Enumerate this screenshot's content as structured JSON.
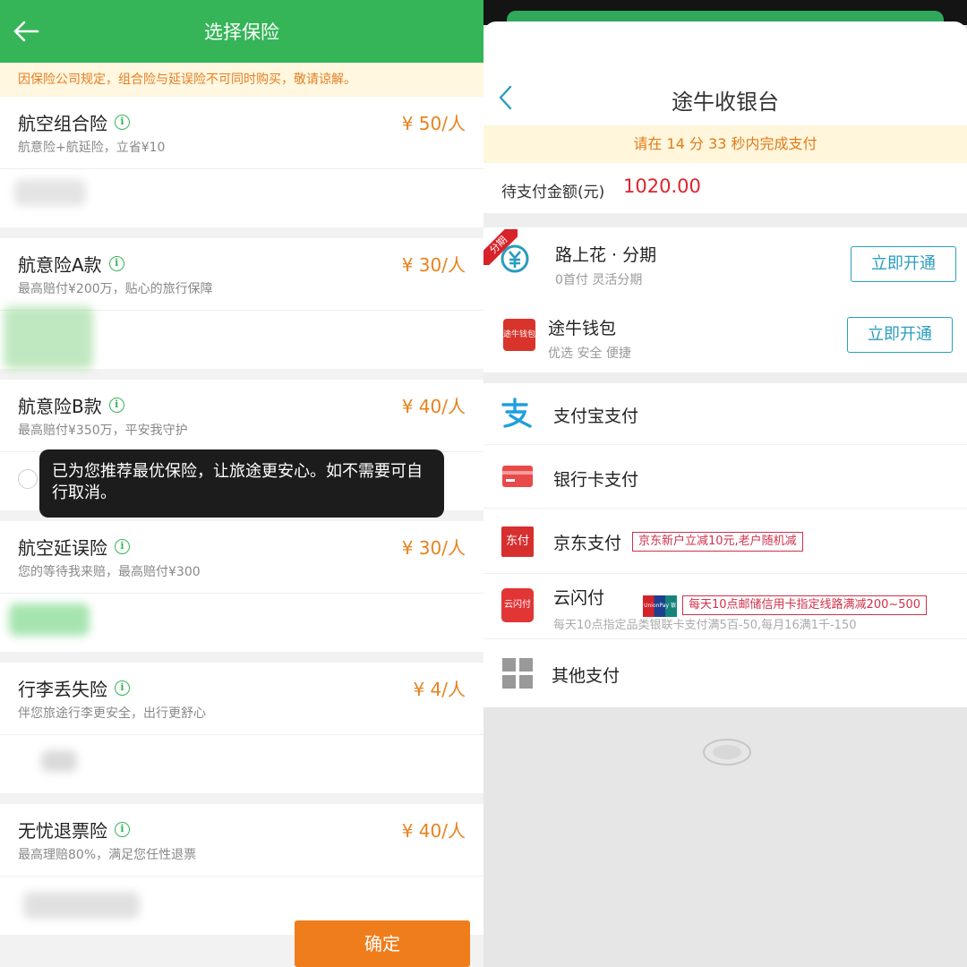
{
  "left": {
    "header": {
      "title": "选择保险"
    },
    "notice": "因保险公司规定，组合险与延误险不可同时购买，敬请谅解。",
    "insurances": [
      {
        "name": "航空组合险",
        "price": "¥ 50/人",
        "desc": "航意险+航延险，立省¥10"
      },
      {
        "name": "航意险A款",
        "price": "¥ 30/人",
        "desc": "最高赔付¥200万，贴心的旅行保障"
      },
      {
        "name": "航意险B款",
        "price": "¥ 40/人",
        "desc": "最高赔付¥350万，平安我守护"
      },
      {
        "name": "航空延误险",
        "price": "¥ 30/人",
        "desc": "您的等待我来赔，最高赔付¥300"
      },
      {
        "name": "行李丢失险",
        "price": "¥ 4/人",
        "desc": "伴您旅途行李更安全，出行更舒心"
      },
      {
        "name": "无忧退票险",
        "price": "¥ 40/人",
        "desc": "最高理赔80%，满足您任性退票"
      }
    ],
    "toast": "已为您推荐最优保险，让旅途更安心。如不需要可自行取消。",
    "confirm_label": "确定"
  },
  "right": {
    "title": "途牛收银台",
    "countdown": "请在 14 分 33 秒内完成支付",
    "amount_label": "待支付金额(元)",
    "amount": "1020.00",
    "fenqi_tag": "分期",
    "methods": {
      "lushanghua": {
        "name": "路上花 · 分期",
        "sub": "0首付 灵活分期",
        "button": "立即开通"
      },
      "wallet": {
        "name": "途牛钱包",
        "sub": "优选 安全 便捷",
        "button": "立即开通",
        "icon_text": "途牛钱包"
      },
      "alipay": {
        "name": "支付宝支付"
      },
      "bankcard": {
        "name": "银行卡支付"
      },
      "jd": {
        "name": "京东支付",
        "promo": "京东新户立减10元,老户随机减",
        "icon_text": "东付"
      },
      "quickpass": {
        "name": "云闪付",
        "promo": "每天10点邮储信用卡指定线路满减200~500",
        "sub": "每天10点指定品类银联卡支付满5百-50,每月16满1千-150",
        "icon_text": "云闪付",
        "unionpay_text": "UnionPay 银联"
      },
      "other": {
        "name": "其他支付"
      }
    }
  },
  "colors": {
    "green": "#35b558",
    "orange": "#f07d1c",
    "price": "#e8821e",
    "red": "#e0232b",
    "blue": "#2a9dc0"
  }
}
